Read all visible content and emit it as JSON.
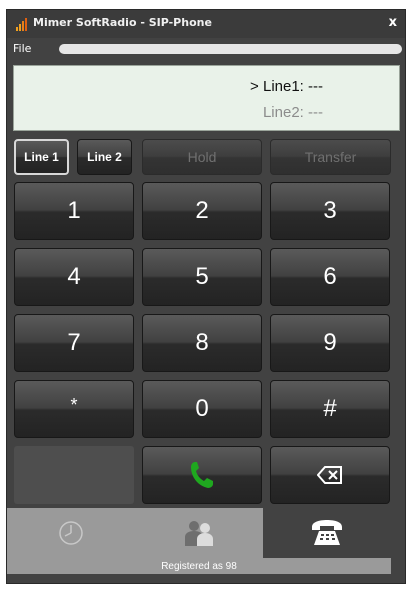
{
  "window": {
    "title": "Mimer SoftRadio - SIP-Phone",
    "close_label": "x"
  },
  "menu": {
    "file": "File"
  },
  "display": {
    "line1": "> Line1: ---",
    "line2": "Line2: ---"
  },
  "line_buttons": [
    {
      "label": "Line 1",
      "active": true
    },
    {
      "label": "Line 2",
      "active": false
    }
  ],
  "func_buttons": {
    "hold": "Hold",
    "transfer": "Transfer"
  },
  "keypad": [
    "1",
    "2",
    "3",
    "4",
    "5",
    "6",
    "7",
    "8",
    "9",
    "*",
    "0",
    "#"
  ],
  "actions": {
    "call_icon": "phone-handset-icon",
    "backspace_icon": "backspace-icon"
  },
  "tabs": [
    {
      "icon": "clock-icon",
      "selected": false
    },
    {
      "icon": "contacts-icon",
      "selected": false
    },
    {
      "icon": "telephone-icon",
      "selected": true
    }
  ],
  "status": "Registered as 98",
  "colors": {
    "call_green": "#1fa81f",
    "display_bg": "#e9f2e9",
    "window_bg": "#424242"
  }
}
